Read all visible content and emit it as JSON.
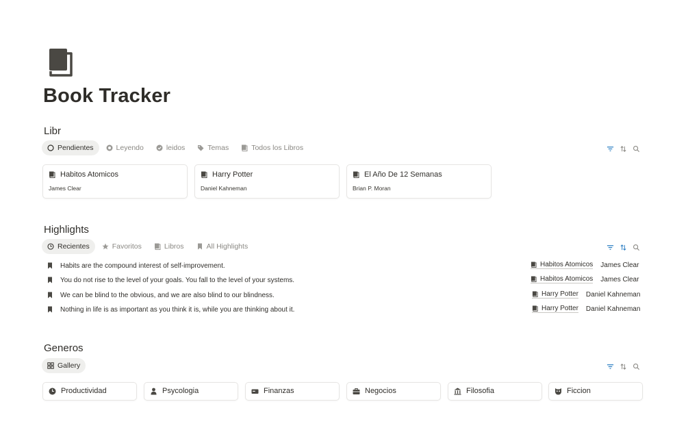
{
  "page": {
    "title": "Book Tracker",
    "icon": "book-icon"
  },
  "libr": {
    "title": "Libr",
    "tabs": [
      {
        "label": "Pendientes",
        "icon": "circle-icon",
        "active": true
      },
      {
        "label": "Leyendo",
        "icon": "half-circle-icon",
        "active": false
      },
      {
        "label": "leidos",
        "icon": "check-circle-icon",
        "active": false
      },
      {
        "label": "Temas",
        "icon": "tag-icon",
        "active": false
      },
      {
        "label": "Todos los Libros",
        "icon": "book-icon",
        "active": false
      }
    ],
    "cards": [
      {
        "title": "Habitos Atomicos",
        "author": "James Clear"
      },
      {
        "title": "Harry Potter",
        "author": "Daniel Kahneman"
      },
      {
        "title": "El Año De 12 Semanas",
        "author": "Brian P. Moran"
      }
    ]
  },
  "highlights": {
    "title": "Highlights",
    "tabs": [
      {
        "label": "Recientes",
        "icon": "clock-icon",
        "active": true
      },
      {
        "label": "Favoritos",
        "icon": "star-icon",
        "active": false
      },
      {
        "label": "Libros",
        "icon": "book-icon",
        "active": false
      },
      {
        "label": "All Highlights",
        "icon": "bookmark-icon",
        "active": false
      }
    ],
    "rows": [
      {
        "text": "Habits are the compound interest of self-improvement.",
        "book": "Habitos Atomicos",
        "author": "James Clear"
      },
      {
        "text": "You do not rise to the level of your goals. You fall to the level of your systems.",
        "book": "Habitos Atomicos",
        "author": "James Clear"
      },
      {
        "text": "We can be blind to the obvious, and we are also blind to our blindness.",
        "book": "Harry Potter",
        "author": "Daniel Kahneman"
      },
      {
        "text": "Nothing in life is as important as you think it is, while you are thinking about it.",
        "book": "Harry Potter",
        "author": "Daniel Kahneman"
      }
    ]
  },
  "generos": {
    "title": "Generos",
    "tabs": [
      {
        "label": "Gallery",
        "icon": "grid-icon",
        "active": true
      }
    ],
    "cards": [
      {
        "label": "Productividad",
        "icon": "clock-icon"
      },
      {
        "label": "Psycologia",
        "icon": "person-icon"
      },
      {
        "label": "Finanzas",
        "icon": "money-icon"
      },
      {
        "label": "Negocios",
        "icon": "briefcase-icon"
      },
      {
        "label": "Filosofia",
        "icon": "building-icon"
      },
      {
        "label": "Ficcion",
        "icon": "mask-icon"
      }
    ]
  },
  "colors": {
    "text": "#2f2d29",
    "muted": "#8a8883",
    "icon": "#4a4843",
    "accent": "#2f80c4"
  }
}
